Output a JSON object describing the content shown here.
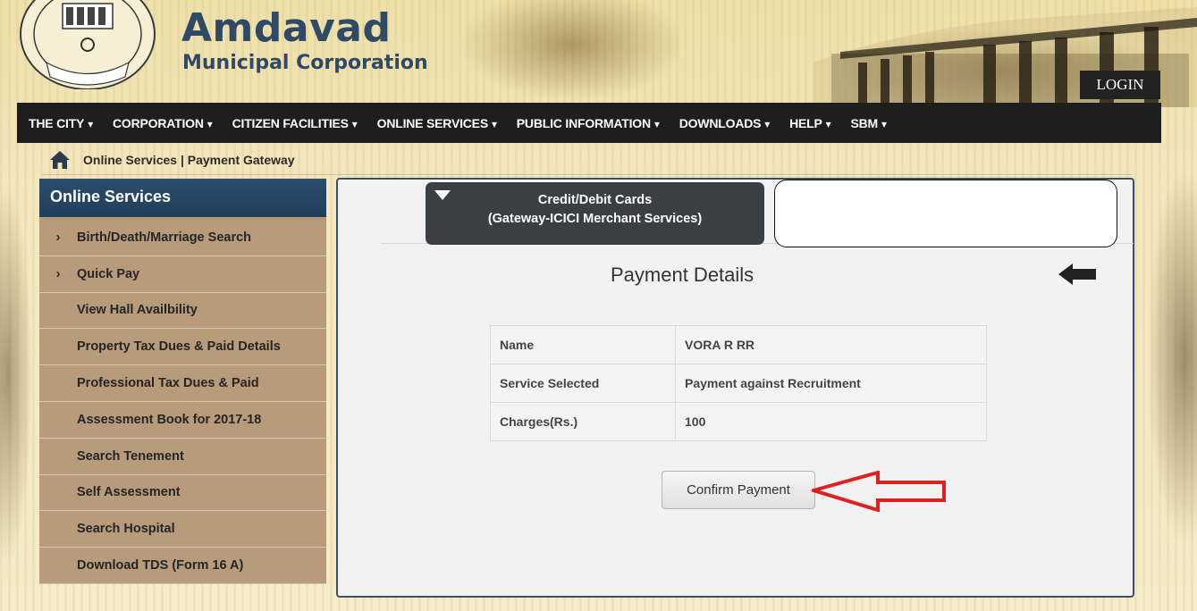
{
  "header": {
    "brand_title": "Amdavad",
    "brand_subtitle": "Municipal Corporation",
    "login_label": "LOGIN"
  },
  "nav": {
    "items": [
      {
        "label": "THE CITY"
      },
      {
        "label": "CORPORATION"
      },
      {
        "label": "CITIZEN FACILITIES"
      },
      {
        "label": "ONLINE SERVICES"
      },
      {
        "label": "PUBLIC INFORMATION"
      },
      {
        "label": "DOWNLOADS"
      },
      {
        "label": "HELP"
      },
      {
        "label": "SBM"
      }
    ],
    "caret_glyph": "▾"
  },
  "breadcrumb": {
    "text": "Online Services | Payment Gateway"
  },
  "sidebar": {
    "title": "Online Services",
    "items": [
      {
        "label": "Birth/Death/Marriage Search",
        "has_chevron": true
      },
      {
        "label": "Quick Pay",
        "has_chevron": true
      },
      {
        "label": "View Hall Availbility",
        "has_chevron": false
      },
      {
        "label": "Property Tax Dues & Paid Details",
        "has_chevron": false
      },
      {
        "label": "Professional Tax Dues & Paid",
        "has_chevron": false
      },
      {
        "label": "Assessment Book for 2017-18",
        "has_chevron": false
      },
      {
        "label": "Search Tenement",
        "has_chevron": false
      },
      {
        "label": "Self Assessment",
        "has_chevron": false
      },
      {
        "label": "Search Hospital",
        "has_chevron": false
      },
      {
        "label": "Download TDS (Form 16 A)",
        "has_chevron": false
      }
    ]
  },
  "main": {
    "tab_active": {
      "line1": "Credit/Debit Cards",
      "line2": "(Gateway-ICICI Merchant Services)"
    },
    "title": "Payment Details",
    "details": [
      {
        "label": "Name",
        "value": "VORA R RR"
      },
      {
        "label": "Service Selected",
        "value": "Payment against Recruitment"
      },
      {
        "label": "Charges(Rs.)",
        "value": "100"
      }
    ],
    "confirm_label": "Confirm Payment"
  },
  "colors": {
    "nav_bg": "#1e1e1e",
    "sidebar_header_bg": "#2c4e6c",
    "sidebar_item_bg": "#b79b7b",
    "tab_active_bg": "#3a3f45",
    "brand_text": "#2f4a66",
    "annotation_arrow": "#e02020"
  },
  "icons": {
    "home": "home-icon",
    "back": "back-arrow-icon",
    "chevron": "chevron-right-icon",
    "tab_triangle": "triangle-down-icon"
  }
}
